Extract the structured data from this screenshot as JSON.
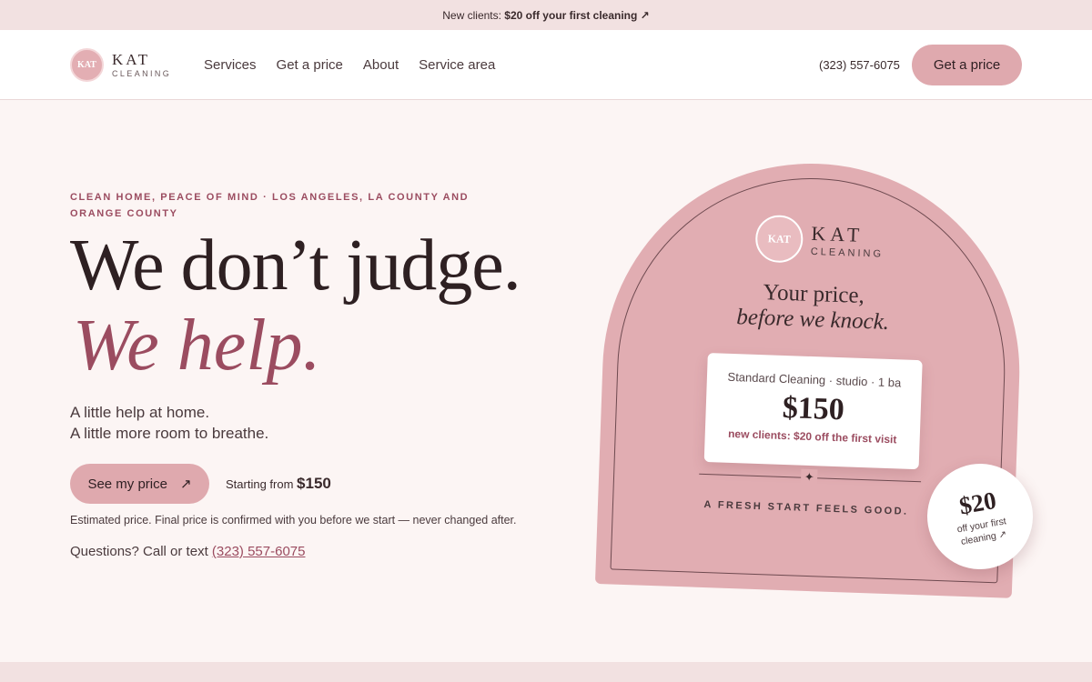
{
  "topbar": {
    "prefix": "New clients: ",
    "offer": "$20 off your first cleaning ↗"
  },
  "brand": {
    "name": "KAT",
    "sub": "CLEANING",
    "mark": "KAT"
  },
  "nav": {
    "items": [
      "Services",
      "Get a price",
      "About",
      "Service area"
    ]
  },
  "header": {
    "phone": "(323) 557-6075",
    "cta": "Get a price"
  },
  "hero": {
    "eyebrow": "Clean home, peace of mind · Los Angeles, LA County and Orange County",
    "headline": "We don’t judge.",
    "headline_italic": "We help.",
    "tagline_1": "A little help at home.",
    "tagline_2": "A little more room to breathe.",
    "cta": "See my price",
    "cta_arrow": "↗",
    "starting_label": "Starting from ",
    "starting_price": "$150",
    "note": "Estimated price. Final price is confirmed with you before we start — never changed after.",
    "questions_label": "Questions? Call or text ",
    "phone": "(323) 557-6075"
  },
  "card": {
    "title_1": "Your price,",
    "title_2": "before we knock.",
    "price_label": "Standard Cleaning · studio · 1 ba",
    "price": "$150",
    "promo": "new clients: $20 off the first visit",
    "star": "✦",
    "footer": "A fresh start feels good."
  },
  "coupon": {
    "amount": "$20",
    "text": "off your first cleaning ↗"
  },
  "colors": {
    "accent": "#9b4c60",
    "pink": "#dfa9ae",
    "background": "#fcf5f4",
    "topbar": "#f2e1e1"
  }
}
